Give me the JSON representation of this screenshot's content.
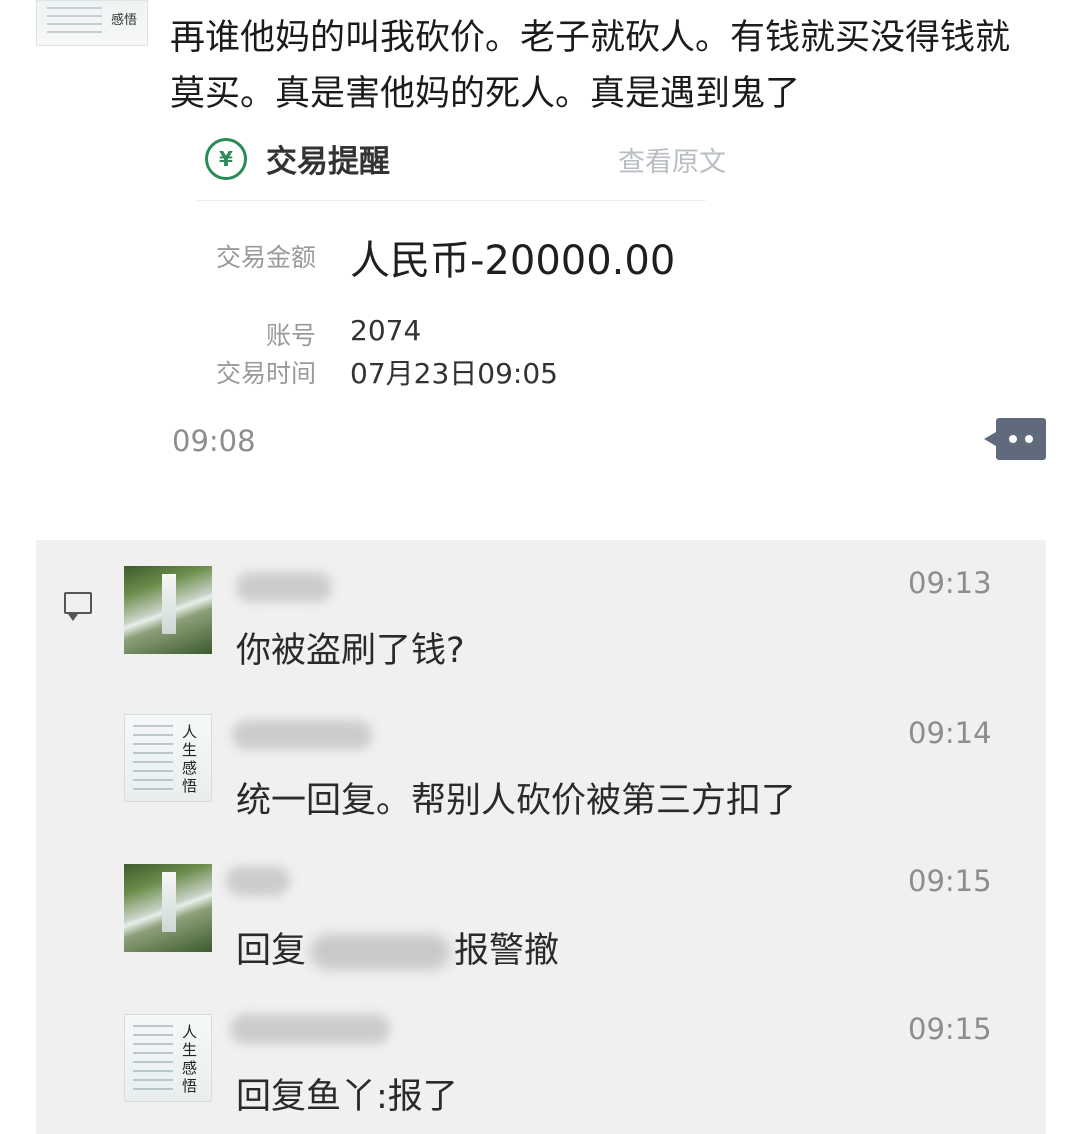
{
  "post": {
    "avatar_caption": "人生感悟",
    "text": "再谁他妈的叫我砍价。老子就砍人。有钱就买没得钱就莫买。真是害他妈的死人。真是遇到鬼了",
    "time": "09:08"
  },
  "transaction_card": {
    "icon": "bank-logo-icon",
    "title": "交易提醒",
    "view_link": "查看原文",
    "amount_label": "交易金额",
    "amount_value": "人民币-20000.00",
    "account_label": "账号",
    "account_value": "2074",
    "time_label": "交易时间",
    "time_value": "07月23日09:05"
  },
  "comments": [
    {
      "avatar": "waterfall",
      "time": "09:13",
      "text": "你被盗刷了钱?"
    },
    {
      "avatar": "card",
      "avatar_caption": "人生感悟",
      "time": "09:14",
      "text": "统一回复。帮别人砍价被第三方扣了"
    },
    {
      "avatar": "waterfall",
      "time": "09:15",
      "text_prefix": "回复",
      "text_suffix": "报警撤"
    },
    {
      "avatar": "card",
      "avatar_caption": "人生感悟",
      "time": "09:15",
      "text": "回复鱼丫:报了"
    }
  ],
  "colors": {
    "bank_green": "#2b8a57",
    "more_button": "#5f6b7d",
    "comment_bg": "#f0f0f0"
  }
}
